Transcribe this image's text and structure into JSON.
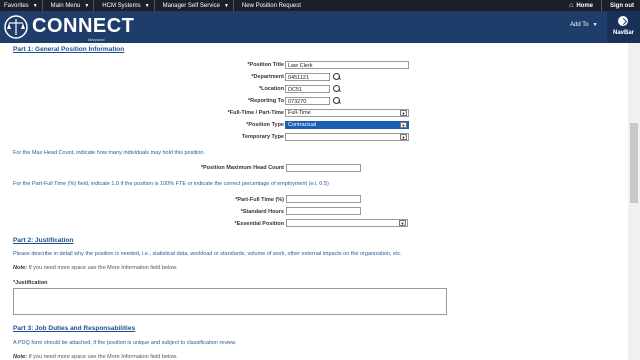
{
  "topbar": {
    "menus": [
      {
        "label": "Favorites"
      },
      {
        "label": "Main Menu"
      },
      {
        "label": "HCM Systems"
      },
      {
        "label": "Manager Self Service"
      },
      {
        "label": "New Position Request"
      }
    ],
    "home_label": "Home",
    "signout_label": "Sign out"
  },
  "header": {
    "logo_text": "CONNECT",
    "logo_sub": "Maryland Judiciary",
    "addto_label": "Add To",
    "navbar_label": "NavBar"
  },
  "part1": {
    "title": "Part 1: General Position Information",
    "position_title_label": "*Position Title",
    "position_title_value": "Law Clerk",
    "department_label": "*Department",
    "department_value": "0451121",
    "location_label": "*Location",
    "location_value": "DC51",
    "reporting_label": "*Reporting To",
    "reporting_value": "073270",
    "fulltime_label": "*Full-Time / Part-Time",
    "fulltime_value": "Full-Time",
    "position_type_label": "*Position Type",
    "position_type_value": "Contractual",
    "temporary_label": "Temporary Type",
    "temporary_value": "",
    "headcount_note": "For the Max Head Count, indicate how many individuals may hold this position.",
    "headcount_label": "*Position Maximum Head Count",
    "fte_note": "For the Part-Full Time (%) field, indicate 1.0 if the position is 100% FTE or indicate the correct percentage of employment (e.i.  0.5)",
    "partfull_label": "*Part-Full Time (%)",
    "std_hours_label": "*Standard Hours",
    "essential_label": "*Essential Position"
  },
  "part2": {
    "title": "Part 2: Justification",
    "desc": "Please describe in detail why the position is needed, i.e., statistical data, workload or standards, volume of work, other external impacts on the organization, etc.",
    "note_label": "Note:",
    "note_text": " If you need more space use the More Information field below.",
    "justification_label": "*Justification"
  },
  "part3": {
    "title": "Part 3: Job Duties and Responsabilities",
    "desc": "A PDQ form should be attached, if the position is unique and subject to classification review.",
    "note_label": "Note:",
    "note_text": " If you need more space use the More Information field below."
  }
}
